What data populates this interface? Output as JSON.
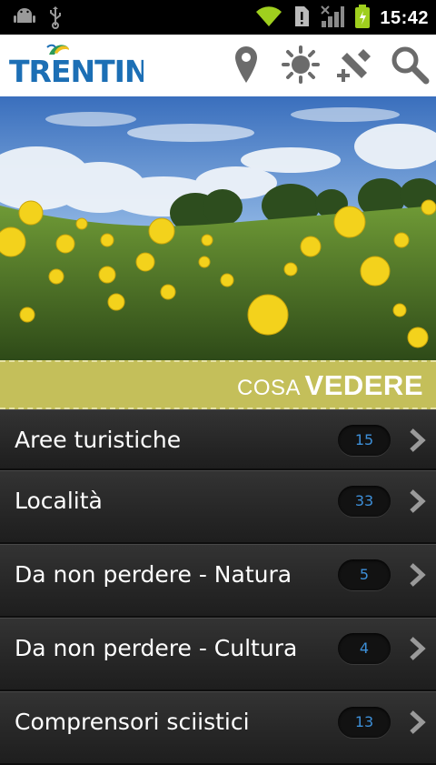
{
  "status_bar": {
    "time": "15:42",
    "icons": [
      "android-debug-icon",
      "usb-icon",
      "wifi-icon",
      "sim-alert-icon",
      "signal-icon",
      "battery-icon"
    ]
  },
  "app_bar": {
    "logo_text": "TRENTINO",
    "actions": [
      "location-pin-icon",
      "weather-sun-icon",
      "favorites-add-icon",
      "search-icon"
    ],
    "brand_green": "#2e9a58",
    "brand_blue": "#1c6fb5"
  },
  "banner": {
    "prefix": "COSA",
    "title": "VEDERE",
    "color": "#c4bf5a"
  },
  "list": {
    "items": [
      {
        "label": "Aree turistiche",
        "count": "15"
      },
      {
        "label": "Località",
        "count": "33"
      },
      {
        "label": "Da non perdere - Natura",
        "count": "5"
      },
      {
        "label": "Da non perdere - Cultura",
        "count": "4"
      },
      {
        "label": "Comprensori sciistici",
        "count": "13"
      }
    ]
  }
}
